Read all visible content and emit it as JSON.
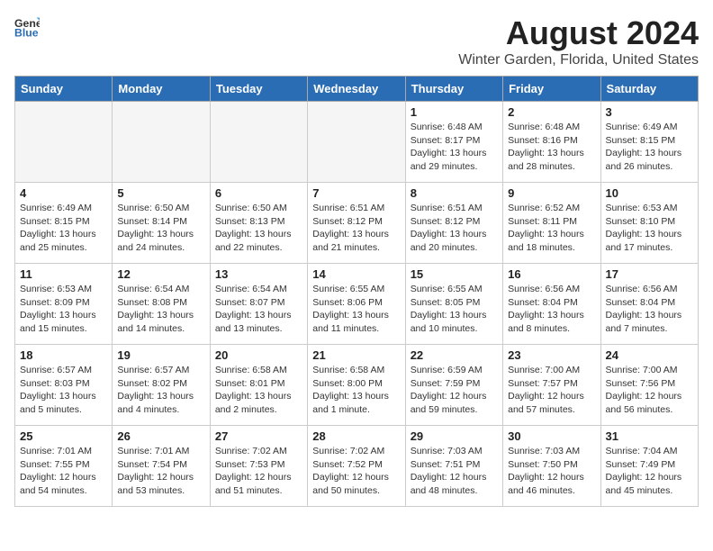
{
  "app": {
    "logo_general": "General",
    "logo_blue": "Blue"
  },
  "title": "August 2024",
  "subtitle": "Winter Garden, Florida, United States",
  "weekdays": [
    "Sunday",
    "Monday",
    "Tuesday",
    "Wednesday",
    "Thursday",
    "Friday",
    "Saturday"
  ],
  "weeks": [
    [
      {
        "day": "",
        "sunrise": "",
        "sunset": "",
        "daylight": "",
        "empty": true
      },
      {
        "day": "",
        "sunrise": "",
        "sunset": "",
        "daylight": "",
        "empty": true
      },
      {
        "day": "",
        "sunrise": "",
        "sunset": "",
        "daylight": "",
        "empty": true
      },
      {
        "day": "",
        "sunrise": "",
        "sunset": "",
        "daylight": "",
        "empty": true
      },
      {
        "day": "1",
        "sunrise": "Sunrise: 6:48 AM",
        "sunset": "Sunset: 8:17 PM",
        "daylight": "Daylight: 13 hours and 29 minutes.",
        "empty": false
      },
      {
        "day": "2",
        "sunrise": "Sunrise: 6:48 AM",
        "sunset": "Sunset: 8:16 PM",
        "daylight": "Daylight: 13 hours and 28 minutes.",
        "empty": false
      },
      {
        "day": "3",
        "sunrise": "Sunrise: 6:49 AM",
        "sunset": "Sunset: 8:15 PM",
        "daylight": "Daylight: 13 hours and 26 minutes.",
        "empty": false
      }
    ],
    [
      {
        "day": "4",
        "sunrise": "Sunrise: 6:49 AM",
        "sunset": "Sunset: 8:15 PM",
        "daylight": "Daylight: 13 hours and 25 minutes.",
        "empty": false
      },
      {
        "day": "5",
        "sunrise": "Sunrise: 6:50 AM",
        "sunset": "Sunset: 8:14 PM",
        "daylight": "Daylight: 13 hours and 24 minutes.",
        "empty": false
      },
      {
        "day": "6",
        "sunrise": "Sunrise: 6:50 AM",
        "sunset": "Sunset: 8:13 PM",
        "daylight": "Daylight: 13 hours and 22 minutes.",
        "empty": false
      },
      {
        "day": "7",
        "sunrise": "Sunrise: 6:51 AM",
        "sunset": "Sunset: 8:12 PM",
        "daylight": "Daylight: 13 hours and 21 minutes.",
        "empty": false
      },
      {
        "day": "8",
        "sunrise": "Sunrise: 6:51 AM",
        "sunset": "Sunset: 8:12 PM",
        "daylight": "Daylight: 13 hours and 20 minutes.",
        "empty": false
      },
      {
        "day": "9",
        "sunrise": "Sunrise: 6:52 AM",
        "sunset": "Sunset: 8:11 PM",
        "daylight": "Daylight: 13 hours and 18 minutes.",
        "empty": false
      },
      {
        "day": "10",
        "sunrise": "Sunrise: 6:53 AM",
        "sunset": "Sunset: 8:10 PM",
        "daylight": "Daylight: 13 hours and 17 minutes.",
        "empty": false
      }
    ],
    [
      {
        "day": "11",
        "sunrise": "Sunrise: 6:53 AM",
        "sunset": "Sunset: 8:09 PM",
        "daylight": "Daylight: 13 hours and 15 minutes.",
        "empty": false
      },
      {
        "day": "12",
        "sunrise": "Sunrise: 6:54 AM",
        "sunset": "Sunset: 8:08 PM",
        "daylight": "Daylight: 13 hours and 14 minutes.",
        "empty": false
      },
      {
        "day": "13",
        "sunrise": "Sunrise: 6:54 AM",
        "sunset": "Sunset: 8:07 PM",
        "daylight": "Daylight: 13 hours and 13 minutes.",
        "empty": false
      },
      {
        "day": "14",
        "sunrise": "Sunrise: 6:55 AM",
        "sunset": "Sunset: 8:06 PM",
        "daylight": "Daylight: 13 hours and 11 minutes.",
        "empty": false
      },
      {
        "day": "15",
        "sunrise": "Sunrise: 6:55 AM",
        "sunset": "Sunset: 8:05 PM",
        "daylight": "Daylight: 13 hours and 10 minutes.",
        "empty": false
      },
      {
        "day": "16",
        "sunrise": "Sunrise: 6:56 AM",
        "sunset": "Sunset: 8:04 PM",
        "daylight": "Daylight: 13 hours and 8 minutes.",
        "empty": false
      },
      {
        "day": "17",
        "sunrise": "Sunrise: 6:56 AM",
        "sunset": "Sunset: 8:04 PM",
        "daylight": "Daylight: 13 hours and 7 minutes.",
        "empty": false
      }
    ],
    [
      {
        "day": "18",
        "sunrise": "Sunrise: 6:57 AM",
        "sunset": "Sunset: 8:03 PM",
        "daylight": "Daylight: 13 hours and 5 minutes.",
        "empty": false
      },
      {
        "day": "19",
        "sunrise": "Sunrise: 6:57 AM",
        "sunset": "Sunset: 8:02 PM",
        "daylight": "Daylight: 13 hours and 4 minutes.",
        "empty": false
      },
      {
        "day": "20",
        "sunrise": "Sunrise: 6:58 AM",
        "sunset": "Sunset: 8:01 PM",
        "daylight": "Daylight: 13 hours and 2 minutes.",
        "empty": false
      },
      {
        "day": "21",
        "sunrise": "Sunrise: 6:58 AM",
        "sunset": "Sunset: 8:00 PM",
        "daylight": "Daylight: 13 hours and 1 minute.",
        "empty": false
      },
      {
        "day": "22",
        "sunrise": "Sunrise: 6:59 AM",
        "sunset": "Sunset: 7:59 PM",
        "daylight": "Daylight: 12 hours and 59 minutes.",
        "empty": false
      },
      {
        "day": "23",
        "sunrise": "Sunrise: 7:00 AM",
        "sunset": "Sunset: 7:57 PM",
        "daylight": "Daylight: 12 hours and 57 minutes.",
        "empty": false
      },
      {
        "day": "24",
        "sunrise": "Sunrise: 7:00 AM",
        "sunset": "Sunset: 7:56 PM",
        "daylight": "Daylight: 12 hours and 56 minutes.",
        "empty": false
      }
    ],
    [
      {
        "day": "25",
        "sunrise": "Sunrise: 7:01 AM",
        "sunset": "Sunset: 7:55 PM",
        "daylight": "Daylight: 12 hours and 54 minutes.",
        "empty": false
      },
      {
        "day": "26",
        "sunrise": "Sunrise: 7:01 AM",
        "sunset": "Sunset: 7:54 PM",
        "daylight": "Daylight: 12 hours and 53 minutes.",
        "empty": false
      },
      {
        "day": "27",
        "sunrise": "Sunrise: 7:02 AM",
        "sunset": "Sunset: 7:53 PM",
        "daylight": "Daylight: 12 hours and 51 minutes.",
        "empty": false
      },
      {
        "day": "28",
        "sunrise": "Sunrise: 7:02 AM",
        "sunset": "Sunset: 7:52 PM",
        "daylight": "Daylight: 12 hours and 50 minutes.",
        "empty": false
      },
      {
        "day": "29",
        "sunrise": "Sunrise: 7:03 AM",
        "sunset": "Sunset: 7:51 PM",
        "daylight": "Daylight: 12 hours and 48 minutes.",
        "empty": false
      },
      {
        "day": "30",
        "sunrise": "Sunrise: 7:03 AM",
        "sunset": "Sunset: 7:50 PM",
        "daylight": "Daylight: 12 hours and 46 minutes.",
        "empty": false
      },
      {
        "day": "31",
        "sunrise": "Sunrise: 7:04 AM",
        "sunset": "Sunset: 7:49 PM",
        "daylight": "Daylight: 12 hours and 45 minutes.",
        "empty": false
      }
    ]
  ]
}
